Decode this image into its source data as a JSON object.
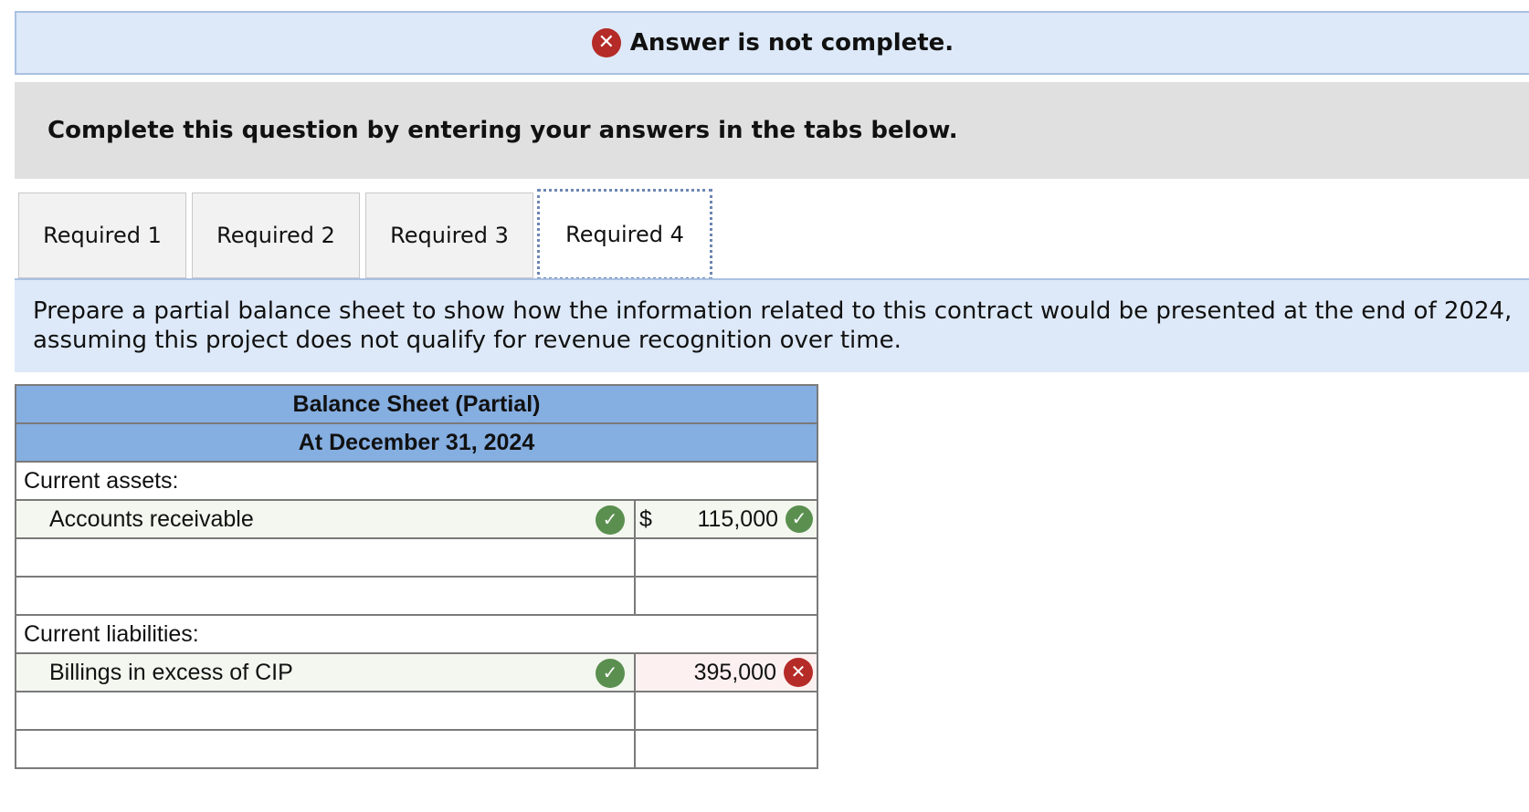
{
  "banner": {
    "status_text": "Answer is not complete.",
    "icon": "x-circle-icon"
  },
  "instructions": {
    "text": "Complete this question by entering your answers in the tabs below."
  },
  "tabs": [
    {
      "label": "Required 1",
      "active": false
    },
    {
      "label": "Required 2",
      "active": false
    },
    {
      "label": "Required 3",
      "active": false
    },
    {
      "label": "Required 4",
      "active": true
    }
  ],
  "prompt": {
    "line1": "Prepare a partial balance sheet to show how the information related to this contract would be presented at the end of 2024,",
    "line2": "assuming this project does not qualify for revenue recognition over time."
  },
  "balance_sheet": {
    "title": "Balance Sheet (Partial)",
    "date": "At December 31, 2024",
    "current_assets_label": "Current assets:",
    "ar_label": "Accounts receivable",
    "ar_currency": "$",
    "ar_amount": "115,000",
    "current_liabilities_label": "Current liabilities:",
    "billings_label": "Billings in excess of CIP",
    "billings_amount": "395,000"
  },
  "colors": {
    "correct": "#5a8f50",
    "incorrect": "#b52b27",
    "header_blue": "#85aee1",
    "banner_blue": "#dde9f8"
  }
}
